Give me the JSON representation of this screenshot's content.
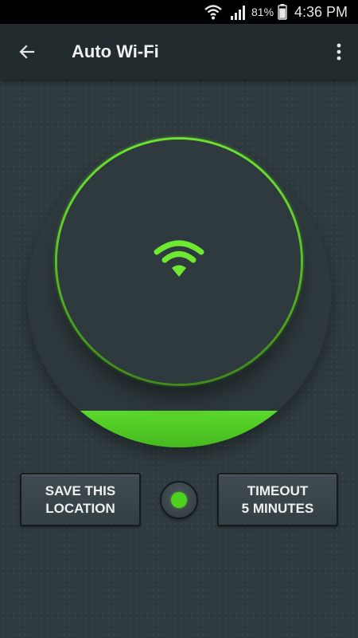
{
  "status_bar": {
    "battery_percent": "81%",
    "time": "4:36 PM",
    "wifi_icon": "wifi-icon",
    "signal_icon": "cell-signal-icon",
    "battery_icon": "battery-icon"
  },
  "toolbar": {
    "title": "Auto Wi-Fi",
    "back_icon": "back-arrow-icon",
    "overflow_icon": "more-vert-icon"
  },
  "dial": {
    "icon": "wifi-icon",
    "accent_color": "#6ee830"
  },
  "buttons": {
    "save_line1": "SAVE THIS",
    "save_line2": "LOCATION",
    "timeout_line1": "TIMEOUT",
    "timeout_line2": "5 MINUTES"
  },
  "indicator": {
    "status_color": "#4fd11f"
  },
  "colors": {
    "background": "#2f3b3f",
    "toolbar": "#222b2e",
    "accent": "#6ee830"
  }
}
